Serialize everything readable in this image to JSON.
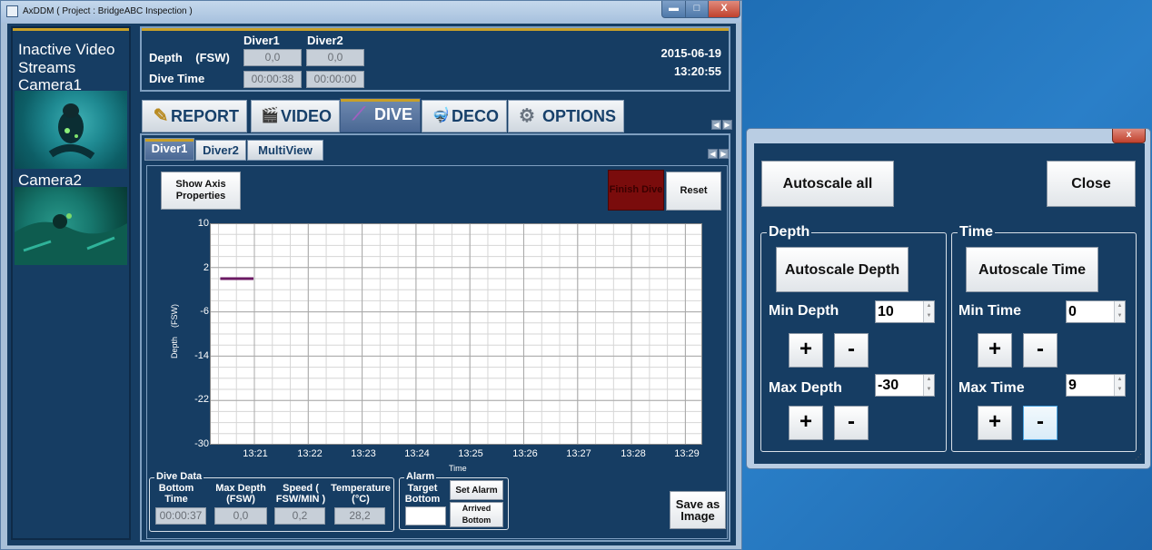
{
  "window": {
    "title": "AxDDM ( Project : BridgeABC Inspection )",
    "min": "▬",
    "max": "□",
    "close": "X"
  },
  "left_panel": {
    "heading": [
      "Inactive Video",
      "Streams"
    ],
    "camera1": "Camera1",
    "camera2": "Camera2"
  },
  "header": {
    "col_diver1": "Diver1",
    "col_diver2": "Diver2",
    "depth_label": "Depth    (FSW)",
    "dive_time_label": "Dive Time",
    "diver1_depth": "0,0",
    "diver2_depth": "0,0",
    "diver1_time": "00:00:38",
    "diver2_time": "00:00:00",
    "date": "2015-06-19",
    "time": "13:20:55"
  },
  "main_tabs": [
    {
      "label": "REPORT",
      "icon": "pencil-icon",
      "glyph": "✎"
    },
    {
      "label": "VIDEO",
      "icon": "clapperboard-icon",
      "glyph": "🎬"
    },
    {
      "label": "DIVE",
      "icon": "chart-line-icon",
      "glyph": "⟋"
    },
    {
      "label": "DECO",
      "icon": "diver-icon",
      "glyph": "🤿"
    },
    {
      "label": "OPTIONS",
      "icon": "gear-icon",
      "glyph": "⚙"
    }
  ],
  "active_main_tab": "DIVE",
  "sub_tabs": [
    "Diver1",
    "Diver2",
    "MultiView"
  ],
  "active_sub_tab": "Diver1",
  "buttons": {
    "show_axis": "Show Axis Properties",
    "finish_dive": "Finish Dive",
    "reset": "Reset",
    "save_image": "Save as Image",
    "set_alarm": "Set Alarm",
    "arrived_bottom": "Arrived Bottom"
  },
  "chart_data": {
    "type": "line",
    "xlabel": "Time",
    "ylabel": "Depth    (FSW)",
    "ylim": [
      -30,
      10
    ],
    "yticks": [
      "10",
      "2",
      "-6",
      "-14",
      "-22",
      "-30"
    ],
    "xticks": [
      "13:21",
      "13:22",
      "13:23",
      "13:24",
      "13:25",
      "13:26",
      "13:27",
      "13:28",
      "13:29"
    ],
    "grid": true,
    "series": [
      {
        "color": "#6b1a63",
        "points": [
          {
            "x": "13:20:22",
            "y": 0.0
          },
          {
            "x": "13:20:59",
            "y": 0.0
          }
        ]
      }
    ]
  },
  "dive_data": {
    "group": "Dive Data",
    "cols": [
      {
        "label": "Bottom Time",
        "value": "00:00:37"
      },
      {
        "label": "Max Depth (FSW)",
        "value": "0,0"
      },
      {
        "label": "Speed ( FSW/MIN )",
        "value": "0,2"
      },
      {
        "label": "Temperature (°C)",
        "value": "28,2"
      }
    ]
  },
  "alarm": {
    "group": "Alarm",
    "target_label": "Target Bottom",
    "target_value": ""
  },
  "dialog": {
    "close_x": "x",
    "autoscale_all": "Autoscale all",
    "close": "Close",
    "depth": {
      "group": "Depth",
      "autoscale": "Autoscale Depth",
      "min_label": "Min Depth",
      "min_value": "10",
      "max_label": "Max Depth",
      "max_value": "-30"
    },
    "time": {
      "group": "Time",
      "autoscale": "Autoscale Time",
      "min_label": "Min Time",
      "min_value": "0",
      "max_label": "Max Time",
      "max_value": "9"
    },
    "plus": "+",
    "minus": "-"
  }
}
